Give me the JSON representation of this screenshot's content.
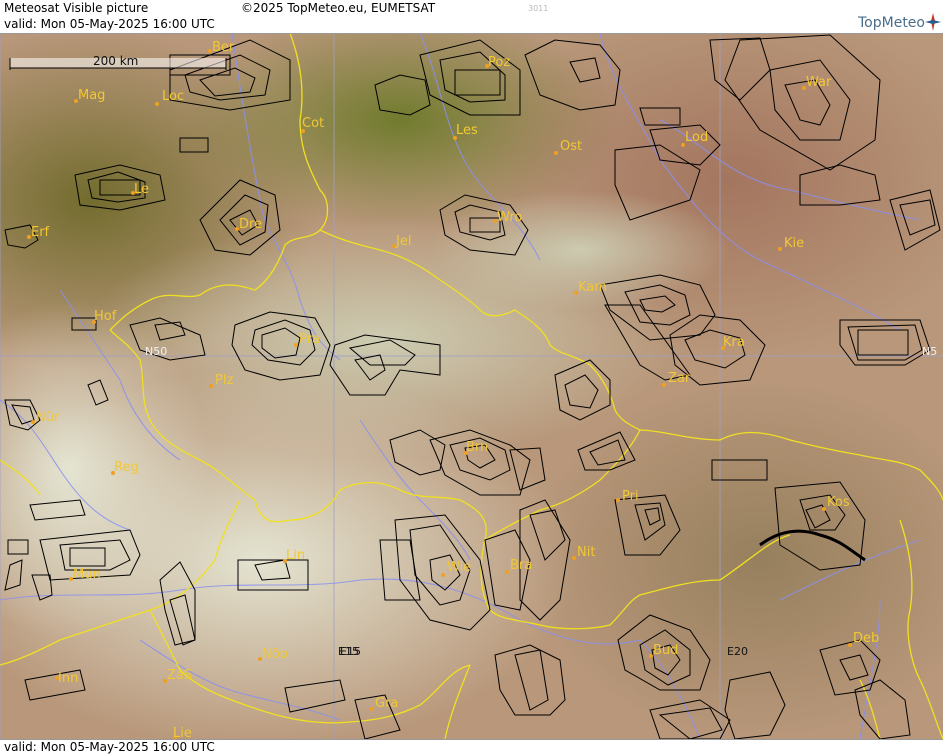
{
  "header": {
    "title": "Meteosat Visible picture",
    "copyright": "©2025 TopMeteo.eu, EUMETSAT",
    "valid": "valid:  Mon  05-May-2025  16:00 UTC",
    "code": "3011",
    "logo": "TopMeteo"
  },
  "footer": {
    "valid": "valid:  Mon  05-May-2025  16:00 UTC"
  },
  "scale": {
    "label": "200 km"
  },
  "grid_labels": [
    {
      "id": "n50-left",
      "text": "N50"
    },
    {
      "id": "n50-right",
      "text": "N5"
    },
    {
      "id": "e15",
      "text": "E15"
    },
    {
      "id": "e20",
      "text": "E20"
    }
  ],
  "cities": [
    {
      "name": "Ber"
    },
    {
      "name": "Poz"
    },
    {
      "name": "War"
    },
    {
      "name": "Mag"
    },
    {
      "name": "Loc"
    },
    {
      "name": "Cot"
    },
    {
      "name": "Les"
    },
    {
      "name": "Lod"
    },
    {
      "name": "Ost"
    },
    {
      "name": "Le"
    },
    {
      "name": "Wro"
    },
    {
      "name": "Dre"
    },
    {
      "name": "Erf"
    },
    {
      "name": "Jel"
    },
    {
      "name": "Kie"
    },
    {
      "name": "Kam"
    },
    {
      "name": "Hof"
    },
    {
      "name": "Pra"
    },
    {
      "name": "Kra"
    },
    {
      "name": "Zar"
    },
    {
      "name": "Plz"
    },
    {
      "name": "Nür"
    },
    {
      "name": "Brn"
    },
    {
      "name": "Reg"
    },
    {
      "name": "Pri"
    },
    {
      "name": "Kos"
    },
    {
      "name": "Lin"
    },
    {
      "name": "Nit"
    },
    {
      "name": "Mün"
    },
    {
      "name": "Wie"
    },
    {
      "name": "Bra"
    },
    {
      "name": "Nöb"
    },
    {
      "name": "E15"
    },
    {
      "name": "Bud"
    },
    {
      "name": "Deb"
    },
    {
      "name": "Inn"
    },
    {
      "name": "ZaS"
    },
    {
      "name": "Gra"
    },
    {
      "name": "Lie"
    }
  ],
  "colors": {
    "city_dot": "#f0a020",
    "city_text": "#f2c833",
    "border": "#f0e020",
    "river": "#8a90f0",
    "contour": "#000000",
    "grid": "#a0a0c0"
  }
}
